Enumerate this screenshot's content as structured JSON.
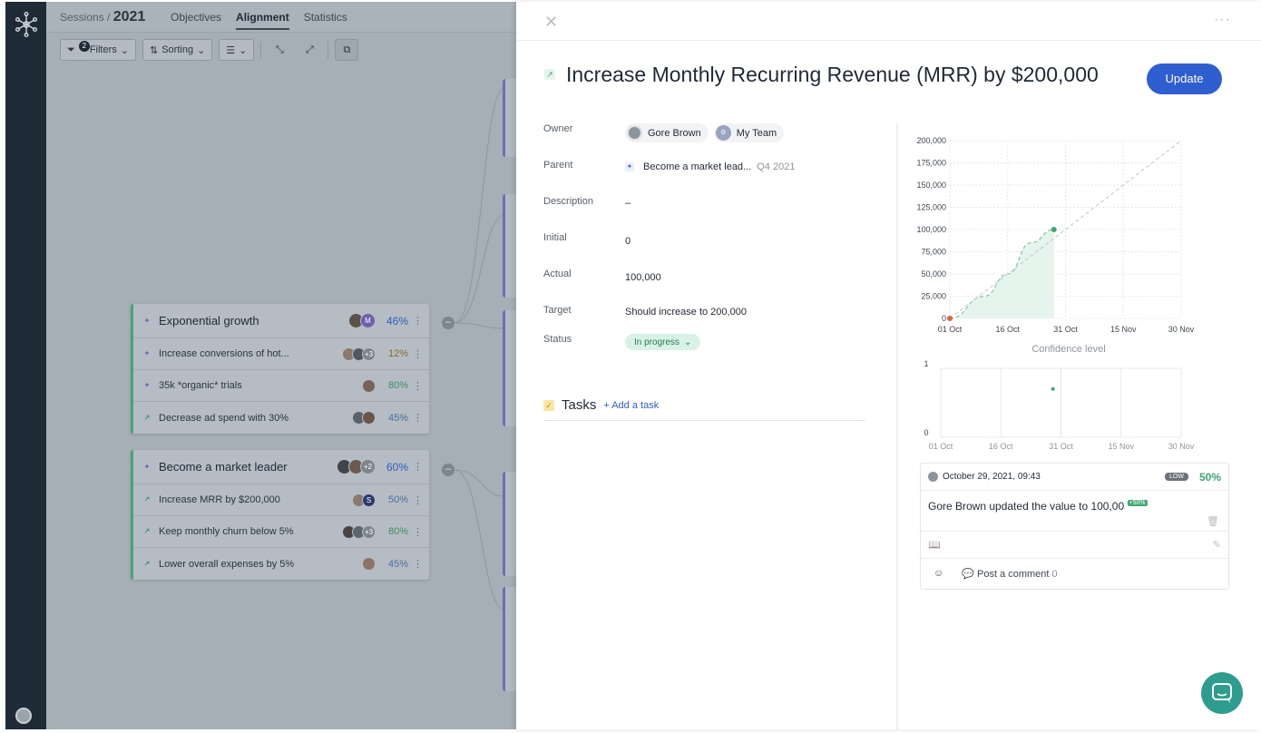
{
  "nav": {
    "breadcrumb_prefix": "Sessions /",
    "breadcrumb_year": "2021",
    "tabs": [
      {
        "label": "Objectives",
        "active": false
      },
      {
        "label": "Alignment",
        "active": true
      },
      {
        "label": "Statistics",
        "active": false
      }
    ]
  },
  "toolbar": {
    "filters_label": "Filters",
    "filters_count": "2",
    "sorting_label": "Sorting"
  },
  "objectives": [
    {
      "title": "Exponential growth",
      "progress": "46%",
      "key_results": [
        {
          "title": "Increase conversions of hot...",
          "progress": "12%",
          "extra_owners": "+3"
        },
        {
          "title": "35k *organic* trials",
          "progress": "80%"
        },
        {
          "title": "Decrease ad spend with 30%",
          "progress": "45%"
        }
      ]
    },
    {
      "title": "Become a market leader",
      "progress": "60%",
      "extra_owners": "+2",
      "key_results": [
        {
          "title": "Increase MRR by $200,000",
          "progress": "50%",
          "owner_initial": "S"
        },
        {
          "title": "Keep monthly churn below 5%",
          "progress": "80%",
          "extra_owners": "+3"
        },
        {
          "title": "Lower overall expenses by 5%",
          "progress": "45%"
        }
      ]
    }
  ],
  "panel": {
    "title": "Increase Monthly Recurring Revenue (MRR) by $200,000",
    "update_label": "Update",
    "fields": {
      "owner_label": "Owner",
      "owner_person": "Gore Brown",
      "owner_team": "My Team",
      "parent_label": "Parent",
      "parent_value": "Become a market lead...",
      "parent_period": "Q4 2021",
      "description_label": "Description",
      "description_value": "–",
      "initial_label": "Initial",
      "initial_value": "0",
      "actual_label": "Actual",
      "actual_value": "100,000",
      "target_label": "Target",
      "target_value": "Should increase to 200,000",
      "status_label": "Status",
      "status_value": "In progress"
    },
    "tasks": {
      "title": "Tasks",
      "add_label": "+ Add a task"
    },
    "confidence_title": "Confidence level",
    "activity": {
      "date": "October 29, 2021, 09:43",
      "confidence_badge": "LOW",
      "progress": "50%",
      "message": "Gore Brown updated the value to 100,00",
      "delta": "+50%",
      "comment_label": "Post a comment",
      "comment_count": "0"
    }
  },
  "colors": {
    "accent": "#2f5ed1",
    "progress_green": "#3fa873",
    "dim_overlay": "#a6aeb6",
    "rail": "#1f2a37"
  },
  "chart_data": [
    {
      "type": "line",
      "title": "",
      "x_ticks": [
        "01 Oct",
        "16 Oct",
        "31 Oct",
        "15 Nov",
        "30 Nov"
      ],
      "y_ticks": [
        0,
        25000,
        50000,
        75000,
        100000,
        125000,
        150000,
        175000,
        200000
      ],
      "ylim": [
        0,
        200000
      ],
      "grid": true,
      "series": [
        {
          "values": [
            {
              "x": "01 Oct",
              "y": 0
            },
            {
              "x": "10 Oct",
              "y": 25000
            },
            {
              "x": "16 Oct",
              "y": 50000
            },
            {
              "x": "22 Oct",
              "y": 85000
            },
            {
              "x": "28 Oct",
              "y": 100000
            }
          ]
        },
        {
          "values": [
            {
              "x": "01 Oct",
              "y": 0
            },
            {
              "x": "30 Nov",
              "y": 200000
            }
          ]
        }
      ],
      "points": [
        {
          "x": "01 Oct",
          "y": 0,
          "color": "#d8663f"
        },
        {
          "x": "28 Oct",
          "y": 100000,
          "color": "#3fa873"
        }
      ]
    },
    {
      "type": "scatter",
      "title": "Confidence level",
      "x_ticks": [
        "01 Oct",
        "16 Oct",
        "31 Oct",
        "15 Nov",
        "30 Nov"
      ],
      "y_ticks": [
        0,
        1
      ],
      "ylim": [
        0,
        1
      ],
      "grid": true,
      "points": [
        {
          "x": "29 Oct",
          "y": 0.7,
          "color": "#3fa873"
        }
      ]
    }
  ]
}
